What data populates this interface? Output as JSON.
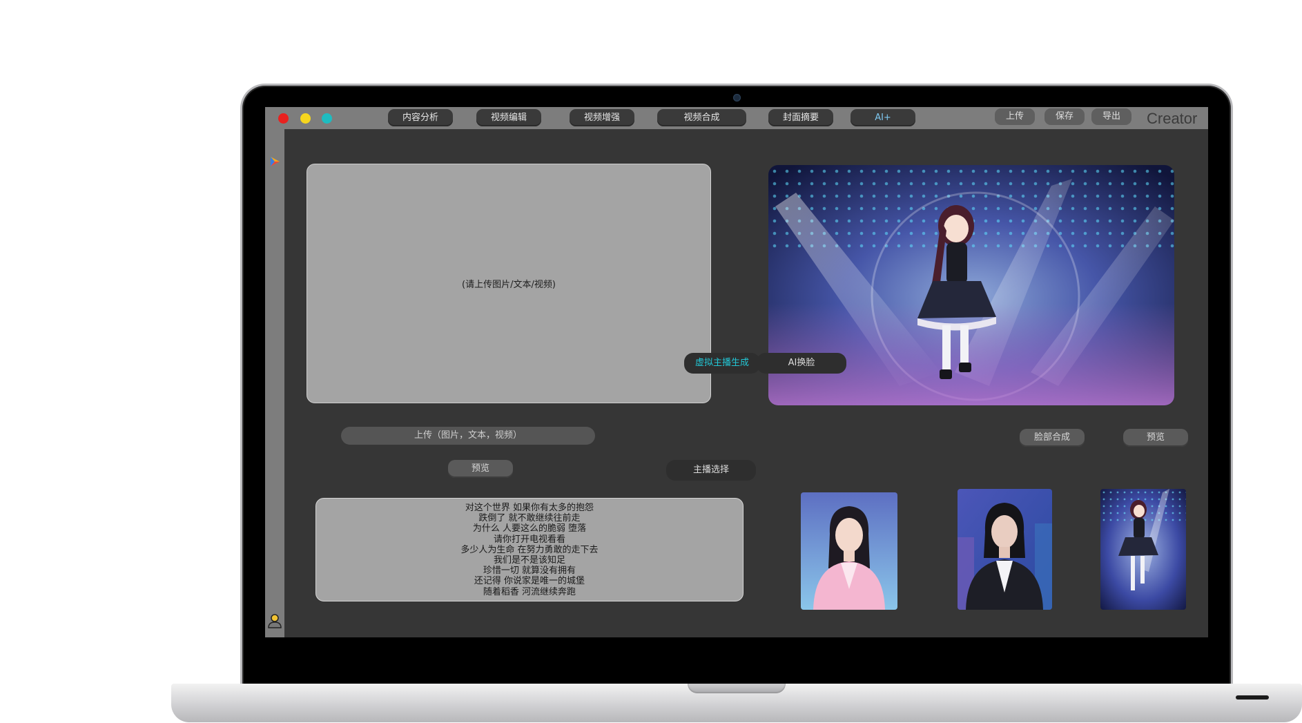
{
  "window": {
    "brand": "Creator"
  },
  "toolbar": {
    "tabs": [
      "内容分析",
      "视频编辑",
      "视频增强",
      "视频合成",
      "封面摘要",
      "AI+"
    ],
    "actions": [
      "上传",
      "保存",
      "导出"
    ]
  },
  "upload_panel": {
    "placeholder": "(请上传图片/文本/视频)",
    "upload_button": "上传（图片，文本，视频）",
    "preview_button": "预览"
  },
  "lyrics": [
    "对这个世界 如果你有太多的抱怨",
    "跌倒了 就不敢继续往前走",
    "为什么 人要这么的脆弱 堕落",
    "请你打开电视看看",
    "多少人为生命 在努力勇敢的走下去",
    "我们是不是该知足",
    "珍惜一切 就算没有拥有",
    "还记得 你说家是唯一的城堡",
    "随着稻香 河流继续奔跑"
  ],
  "ai_panel": {
    "tabs": [
      "虚拟主播生成",
      "AI换脸"
    ],
    "face_merge_button": "脸部合成",
    "preview_button": "预览",
    "anchor_select": "主播选择"
  },
  "colors": {
    "active_tab_text": "#22c7d6",
    "ai_plus_text": "#7ec8f0",
    "close": "#e8211f",
    "minimize": "#f6d61e",
    "zoom": "#1ebcc0"
  },
  "icons": {
    "sidebar_top": "play-logo-icon",
    "sidebar_bottom": "user-icon"
  }
}
